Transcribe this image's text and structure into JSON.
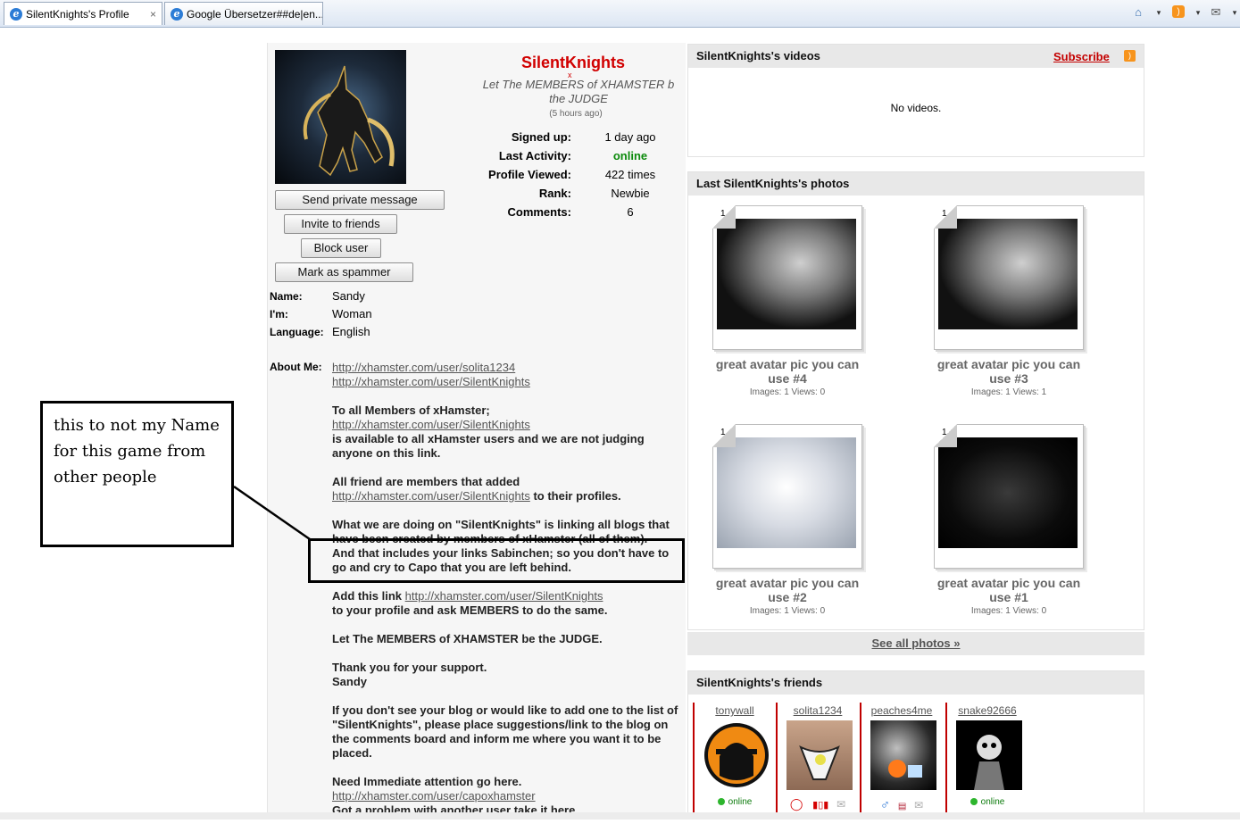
{
  "browser": {
    "tabs": [
      {
        "label": "SilentKnights's Profile",
        "close": "×"
      },
      {
        "label": "Google Übersetzer##de|en..."
      }
    ],
    "commands": {
      "home": "⌂",
      "rss": ")",
      "mail": "✉",
      "dropdown": "▾"
    }
  },
  "profile": {
    "username": "SilentKnights",
    "x_mark": "x",
    "status_line1": "Let The MEMBERS of XHAMSTER b",
    "status_line2": "the JUDGE",
    "status_time": "(5 hours ago)",
    "stats": [
      {
        "label": "Signed up:",
        "value": "1 day ago"
      },
      {
        "label": "Last Activity:",
        "value": "online"
      },
      {
        "label": "Profile Viewed:",
        "value": "422 times"
      },
      {
        "label": "Rank:",
        "value": "Newbie"
      },
      {
        "label": "Comments:",
        "value": "6"
      }
    ],
    "buttons": {
      "send_message": "Send private message",
      "invite": "Invite to friends",
      "block": "Block user",
      "spammer": "Mark as spammer"
    },
    "info": [
      {
        "label": "Name:",
        "value": "Sandy"
      },
      {
        "label": "I'm:",
        "value": "Woman"
      },
      {
        "label": "Language:",
        "value": "English"
      }
    ],
    "about_label": "About Me:",
    "about": {
      "link1": "http://xhamster.com/user/solita1234",
      "link2": "http://xhamster.com/user/SilentKnights",
      "p1_a": "To all Members of xHamster;",
      "p1_link": "http://xhamster.com/user/SilentKnights",
      "p1_b": "is available to all xHamster users and we are not judging anyone on this link.",
      "p2_a": "All friend are members that added",
      "p2_link": "http://xhamster.com/user/SilentKnights",
      "p2_b": " to their profiles.",
      "p3_a": "What we are doing on \"SilentKnights\" is linking all blogs that have been created by members of xHamster (all of them).",
      "p3_b": "And that includes your links Sabinchen; so you don't have to go and cry to Capo that you are left behind.",
      "p4_a": "Add this link ",
      "p4_link": "http://xhamster.com/user/SilentKnights",
      "p4_b": "to your profile and ask MEMBERS to do the same.",
      "p5": "Let The MEMBERS of XHAMSTER be the JUDGE.",
      "p6_a": "Thank you for your support.",
      "p6_b": "Sandy",
      "p7": "If you don't see your blog or would like to add one to the list of \"SilentKnights\", please place suggestions/link to the blog on the comments board and inform me where you want it to be placed.",
      "p8_a": "Need Immediate attention go here.",
      "p8_link": "http://xhamster.com/user/capoxhamster",
      "p8_b": "Got a problem with another user take it here."
    }
  },
  "annotation": {
    "note_line1": "this to not my Name",
    "note_line2": "for this game from",
    "note_line3": "other people"
  },
  "videos": {
    "title": "SilentKnights's videos",
    "subscribe": "Subscribe",
    "empty": "No videos."
  },
  "photos": {
    "title": "Last SilentKnights's photos",
    "items": [
      {
        "count": "1",
        "title_l1": "great avatar pic you can",
        "title_l2": "use #4",
        "meta": "Images: 1 Views: 0"
      },
      {
        "count": "1",
        "title_l1": "great avatar pic you can",
        "title_l2": "use #3",
        "meta": "Images: 1 Views: 1"
      },
      {
        "count": "1",
        "title_l1": "great avatar pic you can",
        "title_l2": "use #2",
        "meta": "Images: 1 Views: 0"
      },
      {
        "count": "1",
        "title_l1": "great avatar pic you can",
        "title_l2": "use #1",
        "meta": "Images: 1 Views: 0"
      }
    ],
    "see_all": "See all photos »"
  },
  "friends": {
    "title": "SilentKnights's friends",
    "items": [
      {
        "name": "tonywall",
        "status": "online"
      },
      {
        "name": "solita1234"
      },
      {
        "name": "peaches4me"
      },
      {
        "name": "snake92666",
        "status": "online"
      }
    ]
  }
}
